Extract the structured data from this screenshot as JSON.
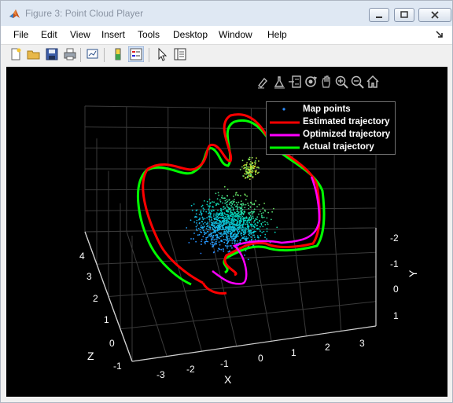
{
  "window": {
    "title": "Figure 3: Point Cloud Player"
  },
  "menu": [
    "File",
    "Edit",
    "View",
    "Insert",
    "Tools",
    "Desktop",
    "Window",
    "Help"
  ],
  "toolbar_icons": [
    "new-figure-icon",
    "open-file-icon",
    "save-icon",
    "print-icon",
    "link-plot-icon",
    "colorbar-icon",
    "legend-icon",
    "pointer-icon",
    "property-inspector-icon"
  ],
  "axes_toolbar_icons": [
    "brush-icon",
    "data-tips-icon",
    "legend-toggle-icon",
    "rotate-3d-icon",
    "pan-icon",
    "zoom-in-icon",
    "zoom-out-icon",
    "home-icon"
  ],
  "colors": {
    "map_points": "#2a8cff",
    "estimated": "#ff0000",
    "optimized": "#ff00ff",
    "actual": "#00ff00",
    "background": "#000000"
  },
  "legend": [
    {
      "label": "Map points",
      "type": "marker",
      "color": "#2a8cff"
    },
    {
      "label": "Estimated trajectory",
      "type": "line",
      "color": "#ff0000"
    },
    {
      "label": "Optimized trajectory",
      "type": "line",
      "color": "#ff00ff"
    },
    {
      "label": "Actual trajectory",
      "type": "line",
      "color": "#00ff00"
    }
  ],
  "axes": {
    "x": {
      "label": "X",
      "ticks": [
        "-3",
        "-2",
        "-1",
        "0",
        "1",
        "2",
        "3"
      ]
    },
    "y": {
      "label": "Y",
      "ticks": [
        "-2",
        "-1",
        "0",
        "1"
      ]
    },
    "z": {
      "label": "Z",
      "ticks": [
        "-1",
        "0",
        "1",
        "2",
        "3",
        "4"
      ]
    }
  }
}
